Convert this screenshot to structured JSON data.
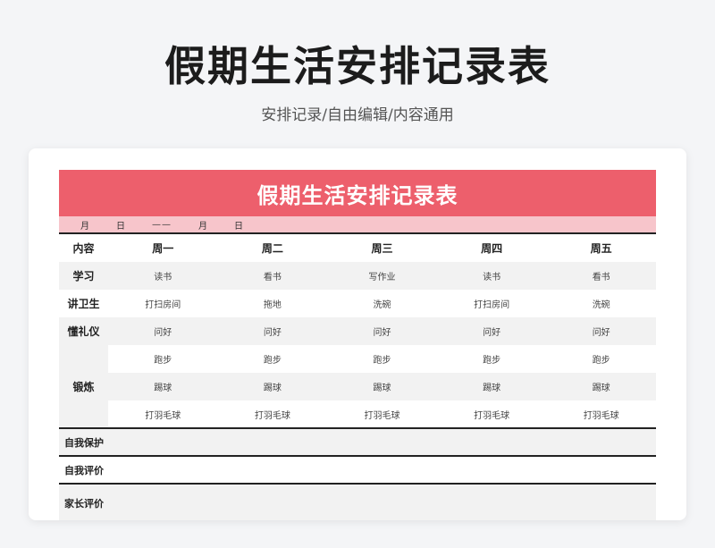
{
  "page": {
    "title": "假期生活安排记录表",
    "subtitle": "安排记录/自由编辑/内容通用"
  },
  "sheet": {
    "banner_title": "假期生活安排记录表",
    "date_row": {
      "month1": "月",
      "day1": "日",
      "dash": "——",
      "month2": "月",
      "day2": "日"
    },
    "header": {
      "content": "内容",
      "days": [
        "周一",
        "周二",
        "周三",
        "周四",
        "周五"
      ]
    },
    "rows": [
      {
        "category": "学习",
        "cells": [
          "读书",
          "看书",
          "写作业",
          "读书",
          "看书"
        ]
      },
      {
        "category": "讲卫生",
        "cells": [
          "打扫房间",
          "拖地",
          "洗碗",
          "打扫房间",
          "洗碗"
        ]
      },
      {
        "category": "懂礼仪",
        "cells": [
          "问好",
          "问好",
          "问好",
          "问好",
          "问好"
        ]
      }
    ],
    "exercise": {
      "category": "锻炼",
      "rows": [
        [
          "跑步",
          "跑步",
          "跑步",
          "跑步",
          "跑步"
        ],
        [
          "踢球",
          "踢球",
          "踢球",
          "踢球",
          "踢球"
        ],
        [
          "打羽毛球",
          "打羽毛球",
          "打羽毛球",
          "打羽毛球",
          "打羽毛球"
        ]
      ]
    },
    "evaluations": [
      "自我保护",
      "自我评价",
      "家长评价"
    ]
  }
}
